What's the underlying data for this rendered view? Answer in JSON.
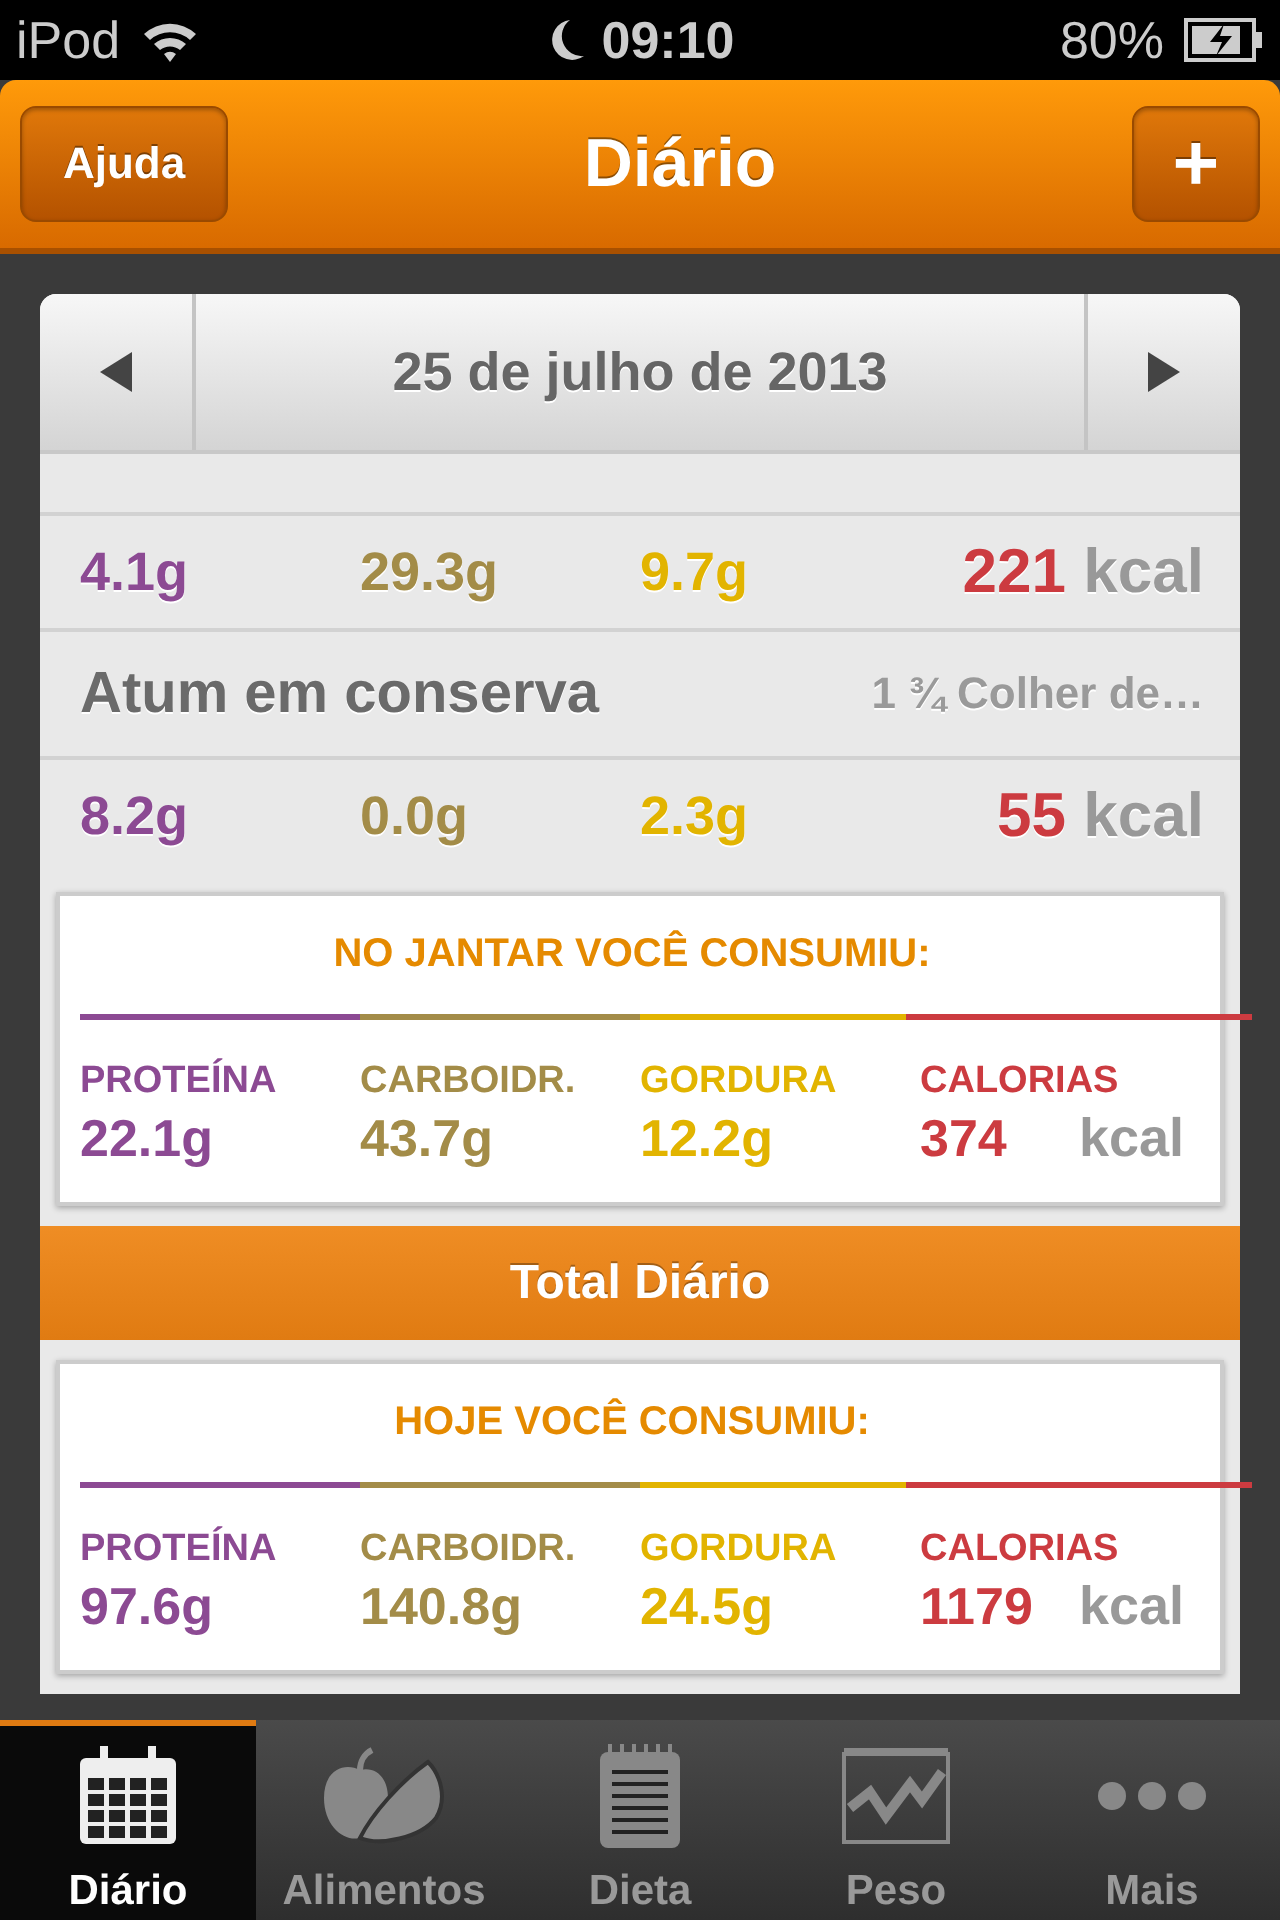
{
  "status_bar": {
    "carrier": "iPod",
    "time": "09:10",
    "battery": "80%"
  },
  "nav": {
    "left_button": "Ajuda",
    "title": "Diário",
    "right_button": "+"
  },
  "date": "25 de julho de 2013",
  "entries": [
    {
      "values": [
        "4.1g",
        "29.3g",
        "9.7g",
        "221"
      ],
      "unit": "kcal"
    },
    {
      "name": "Atum em conserva",
      "portion": "1 ¾ Colher de…",
      "values": [
        "8.2g",
        "0.0g",
        "2.3g",
        "55"
      ],
      "unit": "kcal"
    }
  ],
  "meal_summary": {
    "heading": "NO JANTAR VOCÊ CONSUMIU:",
    "nutrients": [
      {
        "label": "PROTEÍNA",
        "value": "22.1g",
        "color": "#8c4a93"
      },
      {
        "label": "CARBOIDR.",
        "value": "43.7g",
        "color": "#a38c48"
      },
      {
        "label": "GORDURA",
        "value": "12.2g",
        "color": "#e2b400"
      },
      {
        "label": "CALORIAS",
        "value": "374",
        "color": "#cc3b40"
      }
    ],
    "unit": "kcal"
  },
  "total_bar": "Total Diário",
  "day_summary": {
    "heading": "HOJE VOCÊ CONSUMIU:",
    "nutrients": [
      {
        "label": "PROTEÍNA",
        "value": "97.6g",
        "color": "#8c4a93"
      },
      {
        "label": "CARBOIDR.",
        "value": "140.8g",
        "color": "#a38c48"
      },
      {
        "label": "GORDURA",
        "value": "24.5g",
        "color": "#e2b400"
      },
      {
        "label": "CALORIAS",
        "value": "1179",
        "color": "#cc3b40"
      }
    ],
    "unit": "kcal"
  },
  "tabs": [
    {
      "label": "Diário",
      "kind": "calendar",
      "selected": true
    },
    {
      "label": "Alimentos",
      "kind": "fruit",
      "selected": false
    },
    {
      "label": "Dieta",
      "kind": "notepad",
      "selected": false
    },
    {
      "label": "Peso",
      "kind": "graph",
      "selected": false
    },
    {
      "label": "Mais",
      "kind": "dots",
      "selected": false
    }
  ]
}
